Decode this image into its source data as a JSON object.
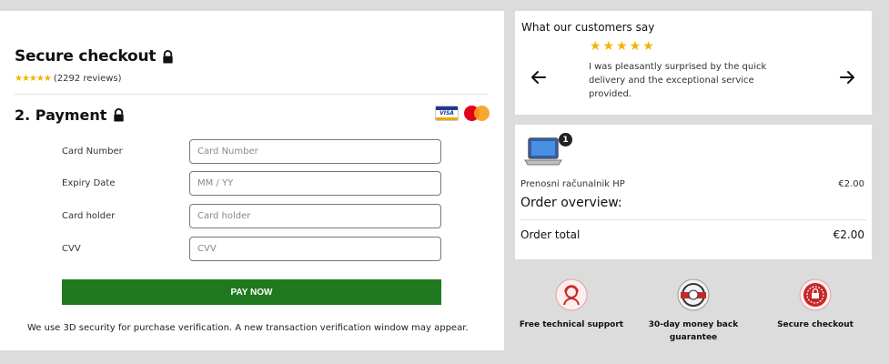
{
  "checkout": {
    "title": "Secure checkout",
    "stars": "★★★★★",
    "reviews": "(2292 reviews)"
  },
  "payment": {
    "title": "2. Payment",
    "card_logos": [
      "visa-logo",
      "mastercard-logo"
    ],
    "fields": [
      {
        "label": "Card Number",
        "placeholder": "Card Number"
      },
      {
        "label": "Expiry Date",
        "placeholder": "MM / YY"
      },
      {
        "label": "Card holder",
        "placeholder": "Card holder"
      },
      {
        "label": "CVV",
        "placeholder": "CVV"
      }
    ],
    "pay_button": "PAY NOW",
    "security_note": "We use 3D security for purchase verification. A new transaction verification window may appear."
  },
  "testimonial": {
    "title": "What our customers say",
    "stars": "★★★★★",
    "quote": "I was pleasantly surprised by the quick delivery and the exceptional service provided."
  },
  "order": {
    "quantity_badge": "1",
    "product_name": "Prenosni računalnik HP",
    "product_price": "€2.00",
    "overview_title": "Order overview:",
    "total_label": "Order total",
    "total_value": "€2.00"
  },
  "trust_badges": [
    {
      "label": "Free technical support",
      "icon": "support-agent-icon"
    },
    {
      "label": "30-day money back guarantee",
      "icon": "money-back-icon"
    },
    {
      "label": "Secure checkout",
      "icon": "secure-seal-icon"
    }
  ],
  "colors": {
    "accent_green": "#1f7a1f",
    "star_gold": "#f2b400",
    "badge_red": "#c62828",
    "page_bg": "#dcdcdc"
  }
}
